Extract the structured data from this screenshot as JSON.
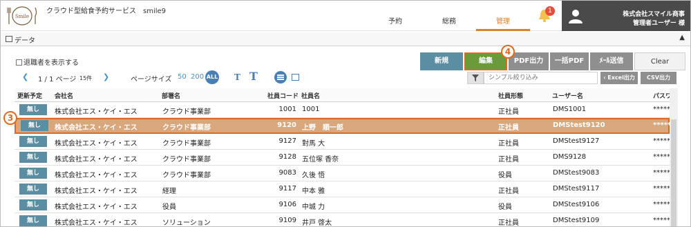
{
  "header": {
    "logo_text": "Smile",
    "app_title": "クラウド型給食予約サービス　smile9",
    "nav": [
      {
        "label": "予約",
        "active": false
      },
      {
        "label": "総務",
        "active": false
      },
      {
        "label": "管理",
        "active": true
      }
    ],
    "notification_count": "1",
    "user": {
      "company": "株式会社スマイル商事",
      "name": "管理者ユーザー 様"
    }
  },
  "section": {
    "title": "データ"
  },
  "toolbar": {
    "show_retired_label": "退職者を表示する",
    "buttons": {
      "new": "新規",
      "edit": "編集",
      "pdf": "PDF出力",
      "bulk_pdf": "一括PDF",
      "mail": "ﾒｰﾙ送信",
      "clear": "Clear"
    },
    "pager": {
      "page_text": "1 / 1 ページ",
      "count": "15件",
      "prev": "❮",
      "next": "❯"
    },
    "page_size": {
      "label": "ページサイズ",
      "options": [
        "50",
        "200",
        "ALL"
      ]
    },
    "font_small": "T",
    "font_large": "T",
    "filter_placeholder": "シンプル絞り込み",
    "excel": "‹ Excel出力",
    "csv": "CSV出力"
  },
  "callouts": {
    "edit": "4",
    "row": "3"
  },
  "table": {
    "columns": [
      "更新予定",
      "会社名",
      "部署名",
      "社員コード",
      "社員名",
      "社員形態",
      "ユーザー名",
      "パスワ"
    ],
    "rows": [
      {
        "status": "無し",
        "company": "株式会社エス・ケイ・エス",
        "dept": "クラウド事業部",
        "code": "1001",
        "name": "1001",
        "type": "正社員",
        "user": "DMS1001",
        "pass": "*****",
        "selected": false
      },
      {
        "status": "無し",
        "company": "株式会社エス・ケイ・エス",
        "dept": "クラウド事業部",
        "code": "9120",
        "name": "上野　順一郎",
        "type": "正社員",
        "user": "DMStest9120",
        "pass": "*****",
        "selected": true
      },
      {
        "status": "無し",
        "company": "株式会社エス・ケイ・エス",
        "dept": "クラウド事業部",
        "code": "9127",
        "name": "對馬 大",
        "type": "正社員",
        "user": "DMStest9127",
        "pass": "*****",
        "selected": false
      },
      {
        "status": "無し",
        "company": "株式会社エス・ケイ・エス",
        "dept": "クラウド事業部",
        "code": "9128",
        "name": "五位塚 香奈",
        "type": "正社員",
        "user": "DMS9128",
        "pass": "*****",
        "selected": false
      },
      {
        "status": "無し",
        "company": "株式会社エス・ケイ・エス",
        "dept": "クラウド事業部",
        "code": "9083",
        "name": "久後 悟",
        "type": "役員",
        "user": "DMStest9083",
        "pass": "*****",
        "selected": false
      },
      {
        "status": "無し",
        "company": "株式会社エス・ケイ・エス",
        "dept": "経理",
        "code": "9117",
        "name": "中本 雅",
        "type": "正社員",
        "user": "DMStest9117",
        "pass": "*****",
        "selected": false
      },
      {
        "status": "無し",
        "company": "株式会社エス・ケイ・エス",
        "dept": "役員",
        "code": "9106",
        "name": "中城 力",
        "type": "役員",
        "user": "DMStest9106",
        "pass": "*****",
        "selected": false
      },
      {
        "status": "無し",
        "company": "株式会社エス・ケイ・エス",
        "dept": "ソリューション",
        "code": "9109",
        "name": "井戸 啓太",
        "type": "正社員",
        "user": "DMStest9109",
        "pass": "*****",
        "selected": false
      }
    ]
  },
  "colors": {
    "accent": "#d4862f",
    "callout": "#e0681f",
    "primary": "#5b8ea3",
    "edit": "#6a9a3a",
    "link": "#4a90c4"
  }
}
